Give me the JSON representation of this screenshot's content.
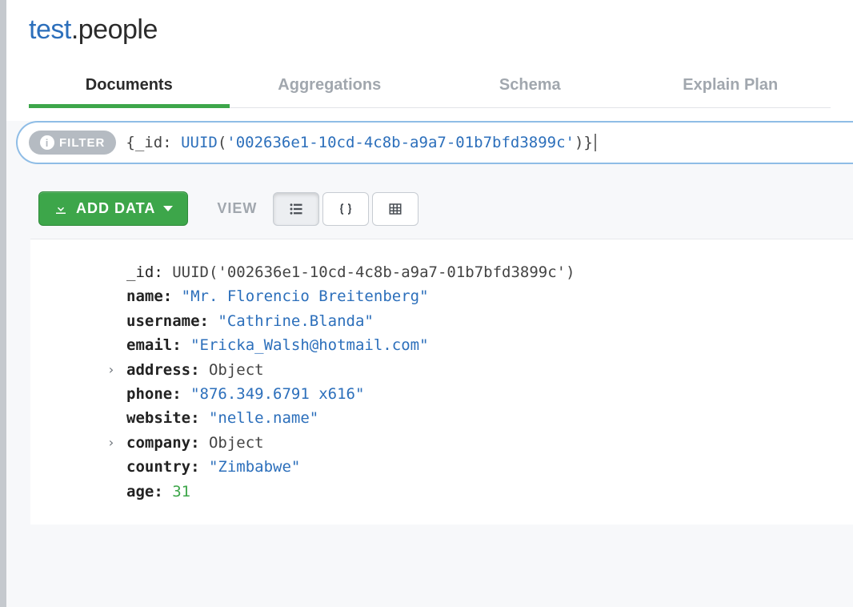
{
  "namespace": {
    "db": "test",
    "coll": "people"
  },
  "tabs": [
    {
      "label": "Documents",
      "active": true
    },
    {
      "label": "Aggregations",
      "active": false
    },
    {
      "label": "Schema",
      "active": false
    },
    {
      "label": "Explain Plan",
      "active": false
    }
  ],
  "filter": {
    "badge": "FILTER",
    "query_open": "{",
    "query_key": "_id",
    "query_sep": ": ",
    "query_func": "UUID",
    "query_paren_open": "(",
    "query_str": "'002636e1-10cd-4c8b-a9a7-01b7bfd3899c'",
    "query_paren_close": ")",
    "query_close": "}"
  },
  "toolbar": {
    "add_label": "ADD DATA",
    "view_label": "VIEW"
  },
  "document": {
    "fields": [
      {
        "key": "_id",
        "keybold": false,
        "type": "raw",
        "value": "UUID('002636e1-10cd-4c8b-a9a7-01b7bfd3899c')",
        "expandable": false
      },
      {
        "key": "name",
        "keybold": true,
        "type": "string",
        "value": "\"Mr. Florencio Breitenberg\"",
        "expandable": false
      },
      {
        "key": "username",
        "keybold": true,
        "type": "string",
        "value": "\"Cathrine.Blanda\"",
        "expandable": false
      },
      {
        "key": "email",
        "keybold": true,
        "type": "string",
        "value": "\"Ericka_Walsh@hotmail.com\"",
        "expandable": false
      },
      {
        "key": "address",
        "keybold": true,
        "type": "object",
        "value": "Object",
        "expandable": true
      },
      {
        "key": "phone",
        "keybold": true,
        "type": "string",
        "value": "\"876.349.6791 x616\"",
        "expandable": false
      },
      {
        "key": "website",
        "keybold": true,
        "type": "string",
        "value": "\"nelle.name\"",
        "expandable": false
      },
      {
        "key": "company",
        "keybold": true,
        "type": "object",
        "value": "Object",
        "expandable": true
      },
      {
        "key": "country",
        "keybold": true,
        "type": "string",
        "value": "\"Zimbabwe\"",
        "expandable": false
      },
      {
        "key": "age",
        "keybold": true,
        "type": "number",
        "value": "31",
        "expandable": false
      }
    ]
  }
}
